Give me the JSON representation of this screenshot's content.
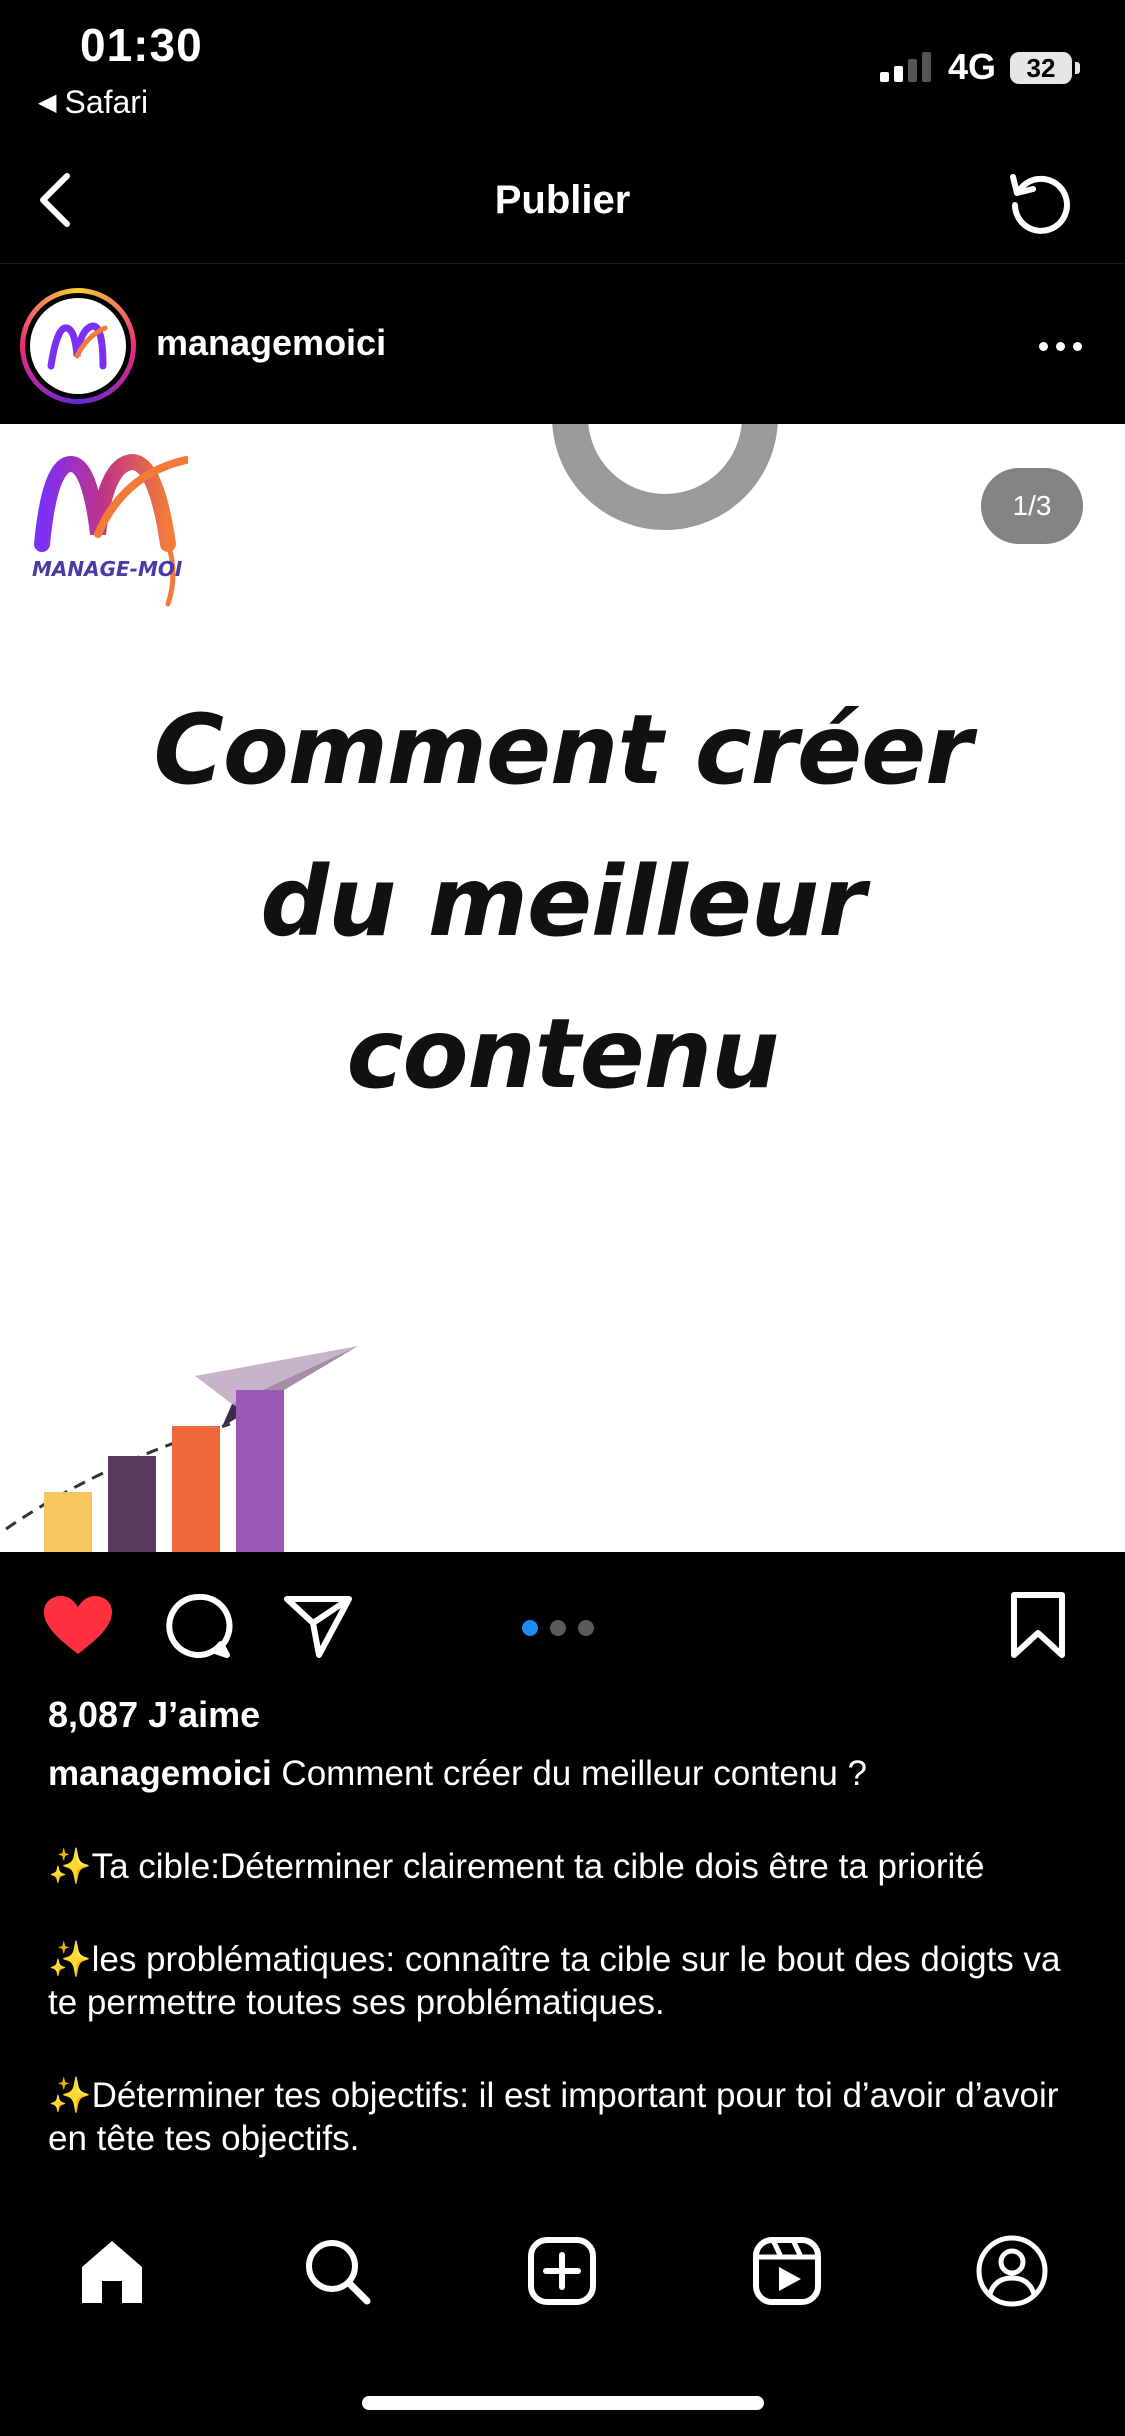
{
  "status_bar": {
    "time": "01:30",
    "back_app": "Safari",
    "network": "4G",
    "battery": "32"
  },
  "header": {
    "title": "Publier",
    "back_icon": "chevron-left-icon",
    "refresh_icon": "refresh-icon"
  },
  "post": {
    "username": "managemoici",
    "media": {
      "brand_text": "MANAGE-MOI",
      "counter": "1/3",
      "headline_lines": [
        "Comment créer",
        "du meilleur",
        "contenu"
      ],
      "page_count": 3,
      "current_page": 1
    },
    "likes": "8,087 J’aime",
    "caption": {
      "username": "managemoici",
      "intro": " Comment créer du meilleur contenu ?",
      "paragraphs": [
        "Ta cible:Déterminer clairement ta cible dois être ta priorité",
        "les problématiques: connaître ta cible sur le bout des doigts va te permettre toutes ses problématiques.",
        "Déterminer tes objectifs: il est important pour toi d’avoir d’avoir en tête tes objectifs."
      ],
      "sparkle": "✨"
    }
  },
  "colors": {
    "like_red": "#ff3040",
    "active_dot": "#1b8cf2",
    "brand_purple": "#7b2ff7",
    "brand_orange": "#f37b3a"
  },
  "tab_bar": {
    "items": [
      "home-icon",
      "search-icon",
      "create-icon",
      "reels-icon",
      "profile-icon"
    ]
  }
}
